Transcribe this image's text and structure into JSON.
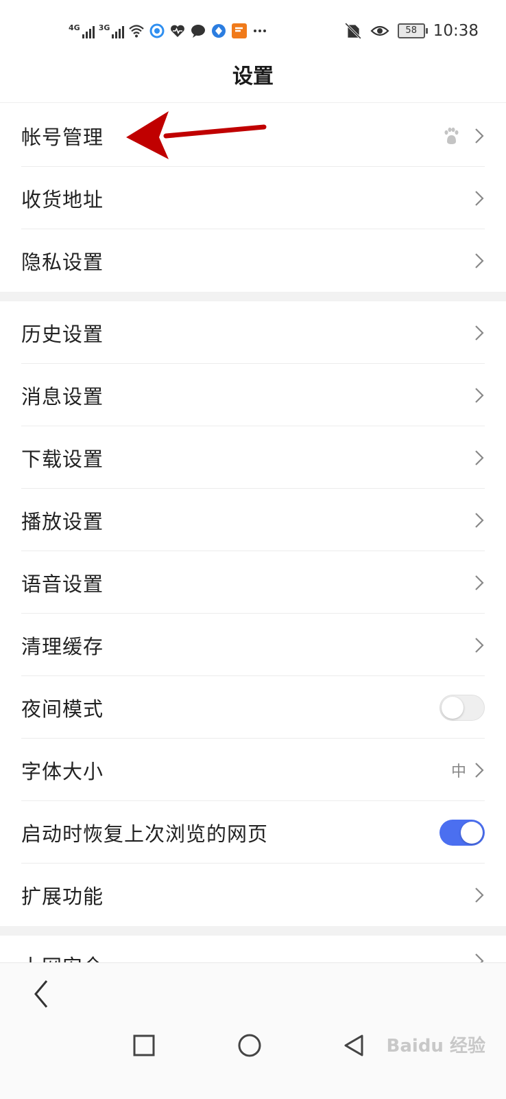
{
  "status_bar": {
    "network_1": "4G",
    "network_2": "3G",
    "battery": "58",
    "time": "10:38",
    "icons": [
      "wifi-icon",
      "browser-icon",
      "health-icon",
      "chat-icon",
      "app-icon",
      "news-icon",
      "more-icon",
      "no-sim-icon",
      "eye-icon"
    ]
  },
  "header": {
    "title": "设置"
  },
  "sections": [
    {
      "items": [
        {
          "label": "帐号管理",
          "control": "chevron",
          "badge_icon": "baidu-paw-icon"
        },
        {
          "label": "收货地址",
          "control": "chevron"
        },
        {
          "label": "隐私设置",
          "control": "chevron"
        }
      ]
    },
    {
      "items": [
        {
          "label": "历史设置",
          "control": "chevron"
        },
        {
          "label": "消息设置",
          "control": "chevron"
        },
        {
          "label": "下载设置",
          "control": "chevron"
        },
        {
          "label": "播放设置",
          "control": "chevron"
        },
        {
          "label": "语音设置",
          "control": "chevron"
        },
        {
          "label": "清理缓存",
          "control": "chevron"
        },
        {
          "label": "夜间模式",
          "control": "toggle",
          "on": false
        },
        {
          "label": "字体大小",
          "control": "chevron",
          "value": "中"
        },
        {
          "label": "启动时恢复上次浏览的网页",
          "control": "toggle",
          "on": true
        },
        {
          "label": "扩展功能",
          "control": "chevron"
        }
      ]
    },
    {
      "items": [
        {
          "label": "上网安全",
          "control": "chevron"
        }
      ]
    }
  ],
  "colors": {
    "accent": "#4b6ff0",
    "annotation_arrow": "#c00000"
  },
  "watermark": "Baidu 经验"
}
